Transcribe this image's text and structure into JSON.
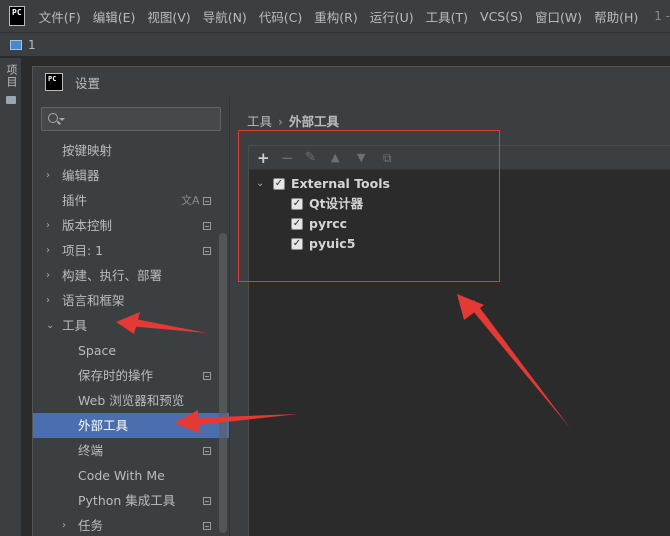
{
  "menubar": {
    "logo": "PC",
    "items": [
      "文件(F)",
      "编辑(E)",
      "视图(V)",
      "导航(N)",
      "代码(C)",
      "重构(R)",
      "运行(U)",
      "工具(T)",
      "VCS(S)",
      "窗口(W)",
      "帮助(H)"
    ],
    "extra": "1 -"
  },
  "project": {
    "label": "1"
  },
  "toolstrip": {
    "tab": "项目"
  },
  "dialog": {
    "logo": "PC",
    "title": "设置",
    "search": {
      "value": "",
      "placeholder": ""
    },
    "tree": [
      {
        "label": "按键映射",
        "level": 0,
        "arrow": "",
        "badge": false
      },
      {
        "label": "编辑器",
        "level": 0,
        "arrow": "›",
        "badge": false
      },
      {
        "label": "插件",
        "level": 0,
        "arrow": "",
        "badge": true,
        "lang": true
      },
      {
        "label": "版本控制",
        "level": 0,
        "arrow": "›",
        "badge": true
      },
      {
        "label": "项目: 1",
        "level": 0,
        "arrow": "›",
        "badge": true
      },
      {
        "label": "构建、执行、部署",
        "level": 0,
        "arrow": "›",
        "badge": false
      },
      {
        "label": "语言和框架",
        "level": 0,
        "arrow": "›",
        "badge": false
      },
      {
        "label": "工具",
        "level": 0,
        "arrow": "⌄",
        "badge": false
      },
      {
        "label": "Space",
        "level": 1,
        "arrow": "",
        "badge": false
      },
      {
        "label": "保存时的操作",
        "level": 1,
        "arrow": "",
        "badge": true
      },
      {
        "label": "Web 浏览器和预览",
        "level": 1,
        "arrow": "",
        "badge": false
      },
      {
        "label": "外部工具",
        "level": 1,
        "arrow": "",
        "badge": false,
        "selected": true
      },
      {
        "label": "终端",
        "level": 1,
        "arrow": "",
        "badge": true
      },
      {
        "label": "Code With Me",
        "level": 1,
        "arrow": "",
        "badge": false
      },
      {
        "label": "Python 集成工具",
        "level": 1,
        "arrow": "",
        "badge": true
      },
      {
        "label": "任务",
        "level": 1,
        "arrow": "›",
        "badge": true
      }
    ],
    "breadcrumb": {
      "first": "工具",
      "separator": "›",
      "second": "外部工具"
    },
    "tools_toolbar": {
      "add": "+",
      "remove": "−",
      "edit": "✎",
      "up": "▲",
      "down": "▼",
      "copy": "⧉"
    },
    "tools_tree": {
      "group": {
        "name": "External Tools",
        "checked": true
      },
      "items": [
        {
          "name": "Qt设计器",
          "checked": true
        },
        {
          "name": "pyrcc",
          "checked": true
        },
        {
          "name": "pyuic5",
          "checked": true
        }
      ]
    }
  },
  "colors": {
    "selected": "#4b6eaf",
    "annotation": "#e03c3c",
    "background": "#3c3f41"
  }
}
